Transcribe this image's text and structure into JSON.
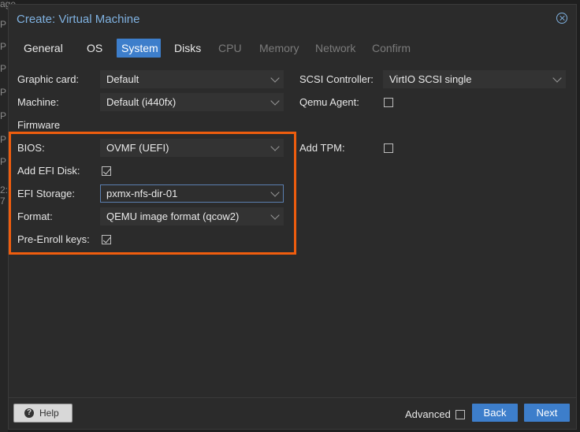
{
  "window": {
    "title": "Create: Virtual Machine"
  },
  "tabs": [
    {
      "label": "General",
      "state": "normal"
    },
    {
      "label": "OS",
      "state": "normal"
    },
    {
      "label": "System",
      "state": "active"
    },
    {
      "label": "Disks",
      "state": "normal"
    },
    {
      "label": "CPU",
      "state": "disabled"
    },
    {
      "label": "Memory",
      "state": "disabled"
    },
    {
      "label": "Network",
      "state": "disabled"
    },
    {
      "label": "Confirm",
      "state": "disabled"
    }
  ],
  "form": {
    "graphic_card": {
      "label": "Graphic card:",
      "value": "Default"
    },
    "machine": {
      "label": "Machine:",
      "value": "Default (i440fx)"
    },
    "firmware_heading": "Firmware",
    "bios": {
      "label": "BIOS:",
      "value": "OVMF (UEFI)"
    },
    "add_efi_disk": {
      "label": "Add EFI Disk:",
      "checked": true
    },
    "efi_storage": {
      "label": "EFI Storage:",
      "value": "pxmx-nfs-dir-01"
    },
    "format": {
      "label": "Format:",
      "value": "QEMU image format (qcow2)"
    },
    "pre_enroll_keys": {
      "label": "Pre-Enroll keys:",
      "checked": true
    },
    "scsi_controller": {
      "label": "SCSI Controller:",
      "value": "VirtIO SCSI single"
    },
    "qemu_agent": {
      "label": "Qemu Agent:",
      "checked": false
    },
    "add_tpm": {
      "label": "Add TPM:",
      "checked": false
    }
  },
  "footer": {
    "help_label": "Help",
    "help_icon_glyph": "?",
    "advanced_label": "Advanced",
    "advanced_checked": false,
    "back_label": "Back",
    "next_label": "Next"
  },
  "background_fragments": [
    "age",
    "P",
    "P",
    "P",
    "P",
    "P",
    "P",
    "2:",
    "7",
    "P"
  ],
  "colors": {
    "accent": "#3d7ecb",
    "title": "#7fb1e0",
    "highlight": "#ef5d0e",
    "window_bg": "#2b2b2b"
  }
}
